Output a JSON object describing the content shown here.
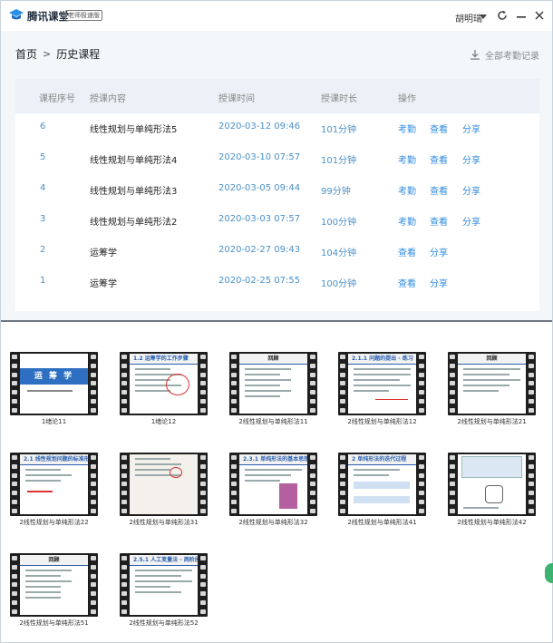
{
  "app": {
    "name": "腾讯课堂",
    "edition": "老师极速版",
    "user": "胡明瑞"
  },
  "breadcrumb": {
    "home": "首页",
    "separator": ">",
    "current": "历史课程"
  },
  "actions": {
    "all_records": "全部考勤记录"
  },
  "table": {
    "headers": {
      "num": "课程序号",
      "content": "授课内容",
      "time": "授课时间",
      "duration": "授课时长",
      "ops": "操作"
    },
    "rows": [
      {
        "num": "6",
        "content": "线性规划与单纯形法5",
        "time": "2020-03-12 09:46",
        "duration": "101分钟",
        "attendance": "考勤",
        "view": "查看",
        "share": "分享"
      },
      {
        "num": "5",
        "content": "线性规划与单纯形法4",
        "time": "2020-03-10 07:57",
        "duration": "101分钟",
        "attendance": "考勤",
        "view": "查看",
        "share": "分享"
      },
      {
        "num": "4",
        "content": "线性规划与单纯形法3",
        "time": "2020-03-05 09:44",
        "duration": "99分钟",
        "attendance": "考勤",
        "view": "查看",
        "share": "分享"
      },
      {
        "num": "3",
        "content": "线性规划与单纯形法2",
        "time": "2020-03-03 07:57",
        "duration": "100分钟",
        "attendance": "考勤",
        "view": "查看",
        "share": "分享"
      },
      {
        "num": "2",
        "content": "运筹学",
        "time": "2020-02-27 09:43",
        "duration": "104分钟",
        "view": "查看",
        "share": "分享"
      },
      {
        "num": "1",
        "content": "运筹学",
        "time": "2020-02-25 07:55",
        "duration": "100分钟",
        "view": "查看",
        "share": "分享"
      }
    ]
  },
  "thumbnails": [
    {
      "label": "1绪论11",
      "slide_title": "运 筹 学"
    },
    {
      "label": "1绪论12",
      "slide_title": "1.2 运筹学的工作步骤"
    },
    {
      "label": "2线性规划与单纯形法11",
      "slide_title": "回顾"
    },
    {
      "label": "2线性规划与单纯形法12",
      "slide_title": "2.1.1 问题的提出 - 练习"
    },
    {
      "label": "2线性规划与单纯形法21",
      "slide_title": "回顾"
    },
    {
      "label": "2线性规划与单纯形法22",
      "slide_title": "2.1 线性规划问题的标准形式"
    },
    {
      "label": "2线性规划与单纯形法31",
      "slide_title": ""
    },
    {
      "label": "2线性规划与单纯形法32",
      "slide_title": "2.3.1 单纯形法的基本思想"
    },
    {
      "label": "2线性规划与单纯形法41",
      "slide_title": "2 单纯形法的迭代过程"
    },
    {
      "label": "2线性规划与单纯形法42",
      "slide_title": ""
    },
    {
      "label": "2线性规划与单纯形法51",
      "slide_title": "回顾"
    },
    {
      "label": "2线性规划与单纯形法52",
      "slide_title": "2.5.1 人工变量法 - 两阶段法"
    }
  ],
  "colors": {
    "accent": "#2f8be0",
    "top_bg": "#f3f7fa",
    "header_bg": "#ebf1f6"
  }
}
